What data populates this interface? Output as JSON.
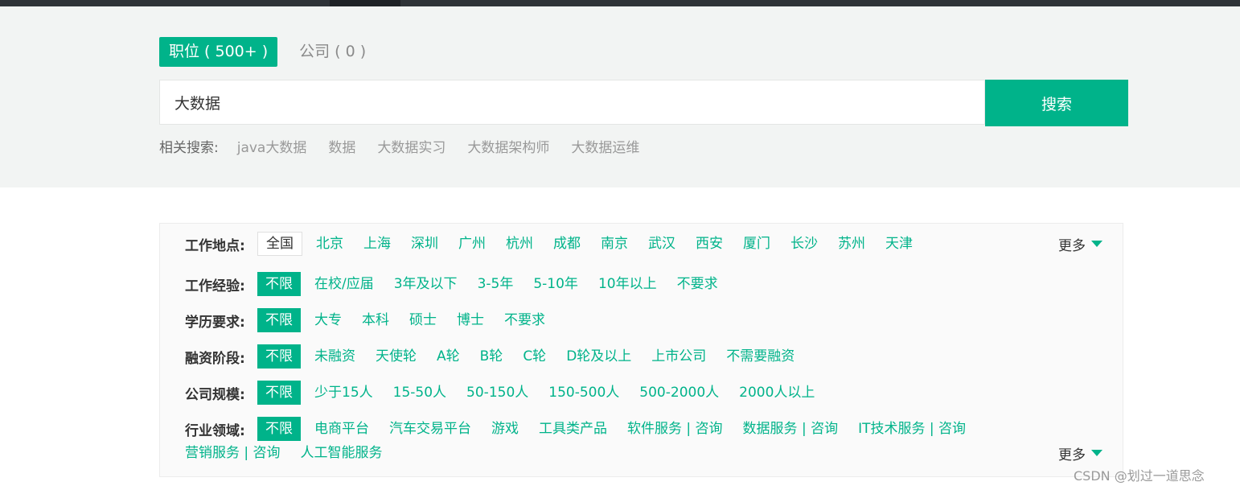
{
  "tabs": [
    {
      "label": "职位 ( 500+ )",
      "active": true
    },
    {
      "label": "公司 ( 0 )",
      "active": false
    }
  ],
  "search": {
    "value": "大数据",
    "button_label": "搜索"
  },
  "related": {
    "label": "相关搜索:",
    "items": [
      "java大数据",
      "数据",
      "大数据实习",
      "大数据架构师",
      "大数据运维"
    ]
  },
  "filters": {
    "location": {
      "label": "工作地点:",
      "selected": "全国",
      "options": [
        "北京",
        "上海",
        "深圳",
        "广州",
        "杭州",
        "成都",
        "南京",
        "武汉",
        "西安",
        "厦门",
        "长沙",
        "苏州",
        "天津"
      ],
      "more": "更多"
    },
    "experience": {
      "label": "工作经验:",
      "selected": "不限",
      "options": [
        "在校/应届",
        "3年及以下",
        "3-5年",
        "5-10年",
        "10年以上",
        "不要求"
      ]
    },
    "education": {
      "label": "学历要求:",
      "selected": "不限",
      "options": [
        "大专",
        "本科",
        "硕士",
        "博士",
        "不要求"
      ]
    },
    "funding": {
      "label": "融资阶段:",
      "selected": "不限",
      "options": [
        "未融资",
        "天使轮",
        "A轮",
        "B轮",
        "C轮",
        "D轮及以上",
        "上市公司",
        "不需要融资"
      ]
    },
    "size": {
      "label": "公司规模:",
      "selected": "不限",
      "options": [
        "少于15人",
        "15-50人",
        "50-150人",
        "150-500人",
        "500-2000人",
        "2000人以上"
      ]
    },
    "industry": {
      "label": "行业领域:",
      "selected": "不限",
      "options": [
        "电商平台",
        "汽车交易平台",
        "游戏",
        "工具类产品",
        "软件服务 | 咨询",
        "数据服务 | 咨询",
        "IT技术服务 | 咨询"
      ],
      "options_row2": [
        "营销服务 | 咨询",
        "人工智能服务"
      ],
      "more": "更多"
    }
  },
  "watermark": "CSDN @划过一道思念",
  "colors": {
    "accent": "#00b38a",
    "topbar": "#2f3338",
    "search_bg": "#f2f4f3"
  }
}
